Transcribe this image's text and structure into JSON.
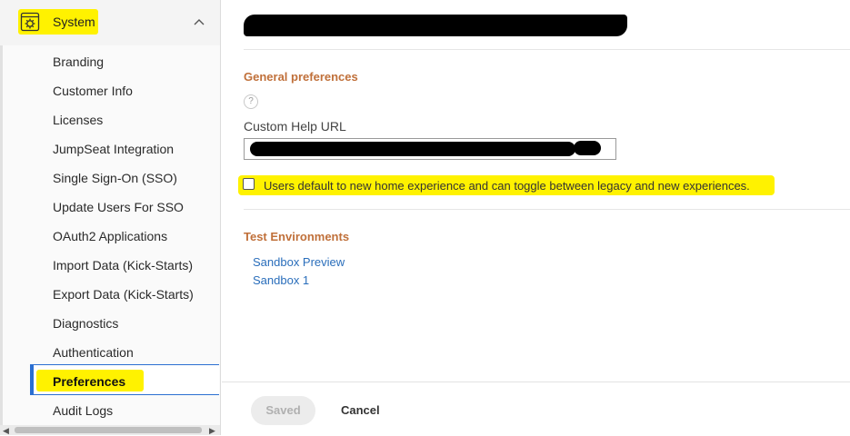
{
  "sidebar": {
    "section": {
      "label": "System",
      "icon": "gear-window-icon",
      "expanded": true
    },
    "items": [
      {
        "label": "Branding"
      },
      {
        "label": "Customer Info"
      },
      {
        "label": "Licenses"
      },
      {
        "label": "JumpSeat Integration"
      },
      {
        "label": "Single Sign-On (SSO)"
      },
      {
        "label": "Update Users For SSO"
      },
      {
        "label": "OAuth2 Applications"
      },
      {
        "label": "Import Data (Kick-Starts)"
      },
      {
        "label": "Export Data (Kick-Starts)"
      },
      {
        "label": "Diagnostics"
      },
      {
        "label": "Authentication"
      },
      {
        "label": "Preferences",
        "active": true
      },
      {
        "label": "Audit Logs"
      }
    ]
  },
  "main": {
    "general": {
      "title": "General preferences",
      "help_glyph": "?",
      "custom_help_url_label": "Custom Help URL",
      "checkbox_label": "Users default to new home experience and can toggle between legacy and new experiences.",
      "checkbox_checked": false
    },
    "test_environments": {
      "title": "Test Environments",
      "links": [
        "Sandbox Preview",
        "Sandbox 1"
      ]
    }
  },
  "footer": {
    "saved_label": "Saved",
    "cancel_label": "Cancel"
  },
  "colors": {
    "highlight": "#fff200",
    "section_title": "#c0703a",
    "link": "#2a6ebb",
    "active_border": "#2b6fd1"
  }
}
